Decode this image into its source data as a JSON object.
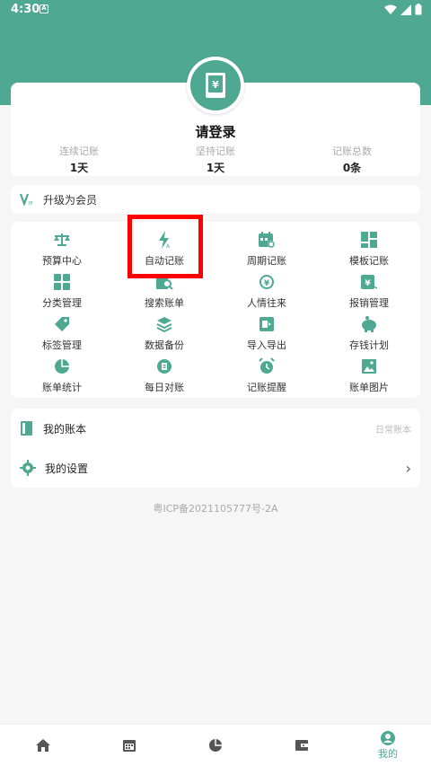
{
  "status_bar": {
    "time": "4:30",
    "notification_glyph": "A"
  },
  "profile": {
    "login_text": "请登录",
    "stats": [
      {
        "label": "连续记账",
        "value": "1天"
      },
      {
        "label": "坚持记账",
        "value": "1天"
      },
      {
        "label": "记账总数",
        "value": "0条"
      }
    ]
  },
  "vip": {
    "label": "升级为会员"
  },
  "features": [
    {
      "label": "预算中心",
      "icon": "scale-icon"
    },
    {
      "label": "自动记账",
      "icon": "bolt-icon"
    },
    {
      "label": "周期记账",
      "icon": "calendar-cycle-icon"
    },
    {
      "label": "模板记账",
      "icon": "grid-icon"
    },
    {
      "label": "分类管理",
      "icon": "category-icon"
    },
    {
      "label": "搜索账单",
      "icon": "search-bill-icon"
    },
    {
      "label": "人情往来",
      "icon": "exchange-icon"
    },
    {
      "label": "报销管理",
      "icon": "reimburse-icon"
    },
    {
      "label": "标签管理",
      "icon": "tag-icon"
    },
    {
      "label": "数据备份",
      "icon": "layers-icon"
    },
    {
      "label": "导入导出",
      "icon": "import-export-icon"
    },
    {
      "label": "存钱计划",
      "icon": "piggy-bank-icon"
    },
    {
      "label": "账单统计",
      "icon": "pie-chart-icon"
    },
    {
      "label": "每日对账",
      "icon": "daily-check-icon"
    },
    {
      "label": "记账提醒",
      "icon": "alarm-icon"
    },
    {
      "label": "账单图片",
      "icon": "image-icon"
    }
  ],
  "menu": {
    "my_books": {
      "label": "我的账本",
      "sub": "日常账本"
    },
    "settings": {
      "label": "我的设置"
    }
  },
  "icp": "粤ICP备2021105777号-2A",
  "tabs": [
    {
      "label": "",
      "icon": "home-icon"
    },
    {
      "label": "",
      "icon": "calendar-icon"
    },
    {
      "label": "",
      "icon": "chart-icon"
    },
    {
      "label": "",
      "icon": "wallet-icon"
    },
    {
      "label": "我的",
      "icon": "profile-icon"
    }
  ],
  "colors": {
    "accent": "#4fa892",
    "highlight": "#ff0000"
  }
}
